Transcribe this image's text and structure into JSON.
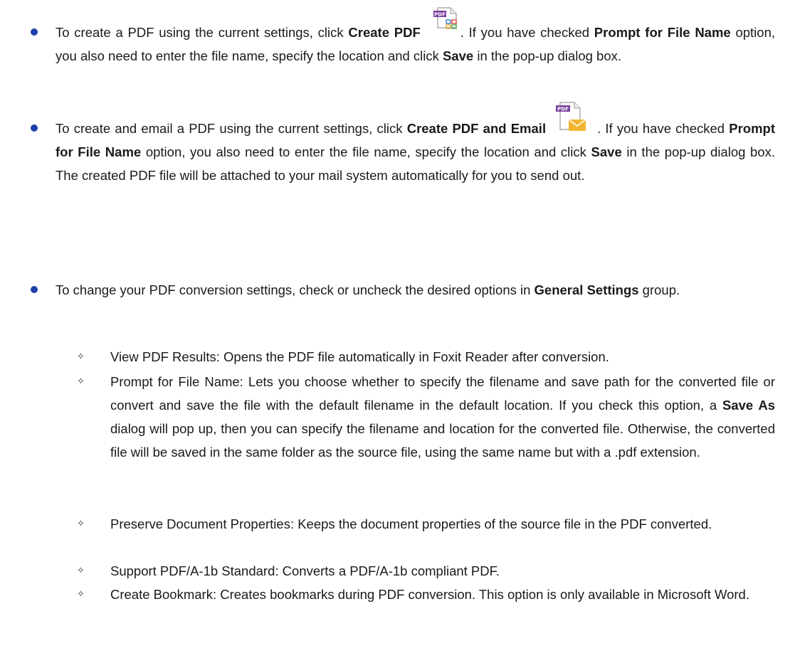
{
  "bullets": [
    {
      "text_a": "To create a PDF using the current settings, click ",
      "bold_a": "Create PDF",
      "text_b": ". If you have checked ",
      "bold_b": "Prompt for File Name",
      "text_c": " option, you also need to enter the file name, specify the location and click ",
      "bold_c": "Save",
      "text_d": " in the pop-up dialog box.",
      "icon": "create-pdf-icon"
    },
    {
      "text_a": "To create and email a PDF using the current settings, click ",
      "bold_a": "Create PDF and Email",
      "text_b": ". If you have checked ",
      "bold_b": "Prompt for File Name",
      "text_c": " option, you also need to enter the file name, specify the location and click ",
      "bold_c": "Save",
      "text_d": " in the pop-up dialog box. The created PDF file will be attached to your mail system automatically for you to send out.",
      "icon": "create-pdf-email-icon"
    },
    {
      "text_a": "To change your PDF conversion settings, check or uncheck the desired options in ",
      "bold_a": "General Settings",
      "text_b": " group."
    }
  ],
  "icon_label": "PDF",
  "options": [
    {
      "text": "View PDF Results: Opens the PDF file automatically in Foxit Reader after conversion."
    },
    {
      "text_a": "Prompt for File Name: Lets you choose whether to specify the filename and save path for the converted file or convert and save the file with the default filename in the default location. If you check this option, a ",
      "bold": "Save As",
      "text_b": " dialog will pop up, then you can specify the filename and location for the converted file. Otherwise, the converted file will be saved in the same folder as the source file, using the same name but with a .pdf extension."
    },
    {
      "text": "Preserve Document Properties: Keeps the document properties of the source file in the PDF converted."
    },
    {
      "text": "Support PDF/A-1b Standard: Converts a PDF/A-1b compliant PDF."
    },
    {
      "text": "Create Bookmark: Creates bookmarks during PDF conversion. This option is only available in Microsoft Word."
    }
  ],
  "colors": {
    "bullet": "#1f3ea8",
    "pdf_badge": "#7b3fa0",
    "envelope": "#f2b531"
  }
}
